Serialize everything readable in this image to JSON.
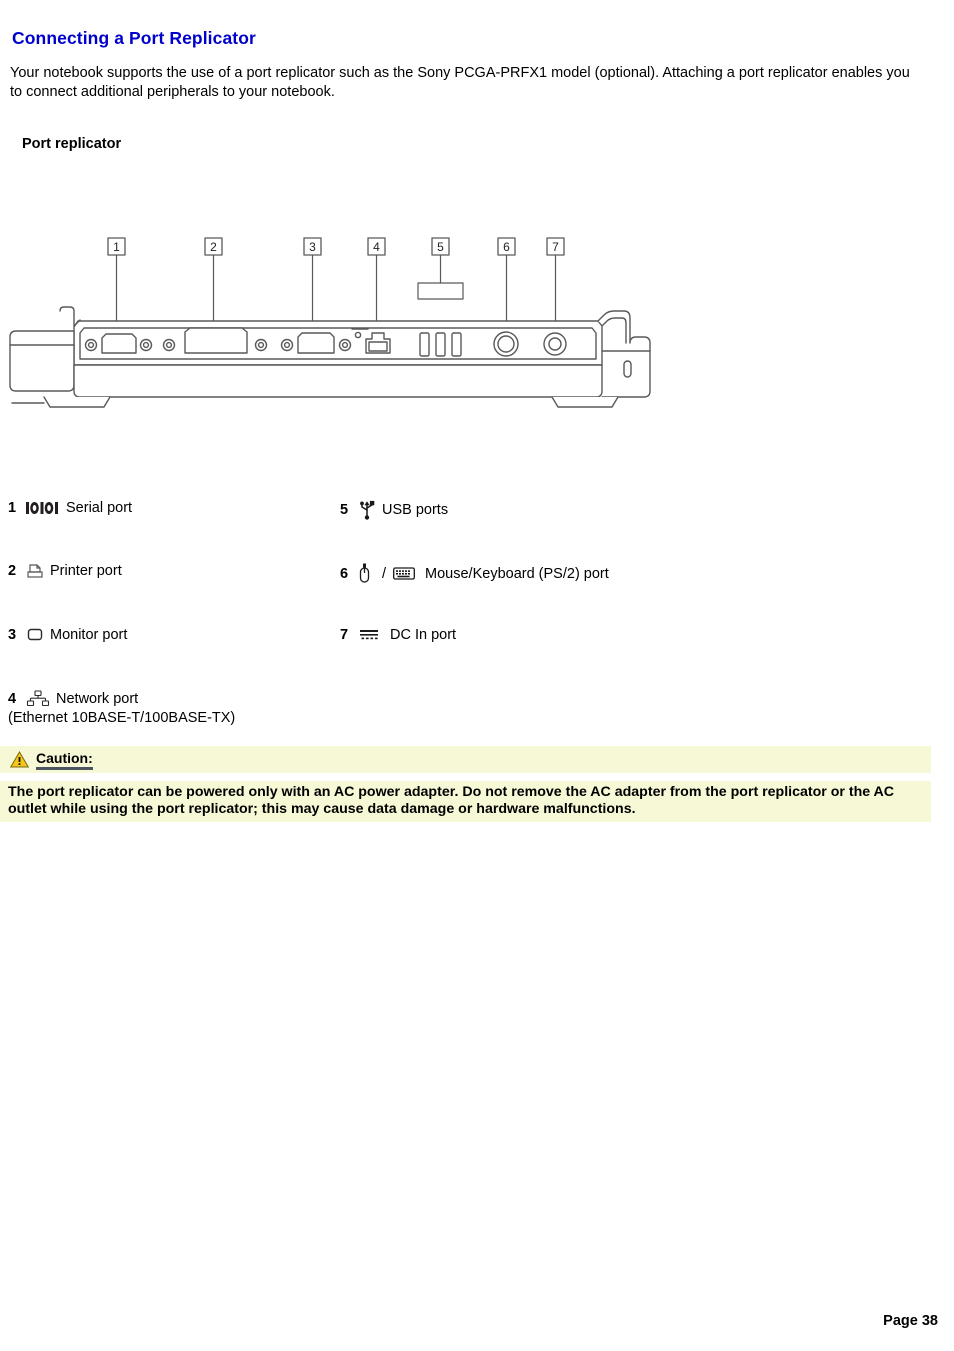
{
  "document": {
    "title": "Connecting a Port Replicator",
    "title_color": "#0000cc",
    "intro": "Your notebook supports the use of a port replicator such as the Sony PCGA-PRFX1 model (optional). Attaching a port replicator enables you to connect additional peripherals to your notebook.",
    "subheading": "Port replicator",
    "page_number": "Page 38"
  },
  "figure": {
    "name": "port-replicator-rear-view",
    "callouts": [
      "1",
      "2",
      "3",
      "4",
      "5",
      "6",
      "7"
    ]
  },
  "legend": {
    "items": [
      {
        "num": "1",
        "icon": "serial-port-icon",
        "label": "Serial port"
      },
      {
        "num": "2",
        "icon": "printer-port-icon",
        "label": "Printer port"
      },
      {
        "num": "3",
        "icon": "monitor-port-icon",
        "label": "Monitor port"
      },
      {
        "num": "4",
        "icon": "network-port-icon",
        "label": "Network port"
      },
      {
        "num": "5",
        "icon": "usb-port-icon",
        "label": "USB ports"
      },
      {
        "num": "6",
        "icon": "mouse-keyboard-icon",
        "label": "Mouse/Keyboard (PS/2) port"
      },
      {
        "num": "7",
        "icon": "dc-in-port-icon",
        "label": "DC In port"
      }
    ],
    "item4_subtext": "(Ethernet 10BASE-T/100BASE-TX)",
    "item6_separator": "/"
  },
  "caution": {
    "icon": "warning-triangle-icon",
    "heading": "Caution:",
    "body": "The port replicator can be powered only with an AC power adapter. Do not remove the AC adapter from the port replicator or the AC outlet while using the port replicator; this may cause data damage or hardware malfunctions.",
    "background_color": "#f7f8d6",
    "underline_color": "#4a5560",
    "icon_color": "#f5c518"
  }
}
